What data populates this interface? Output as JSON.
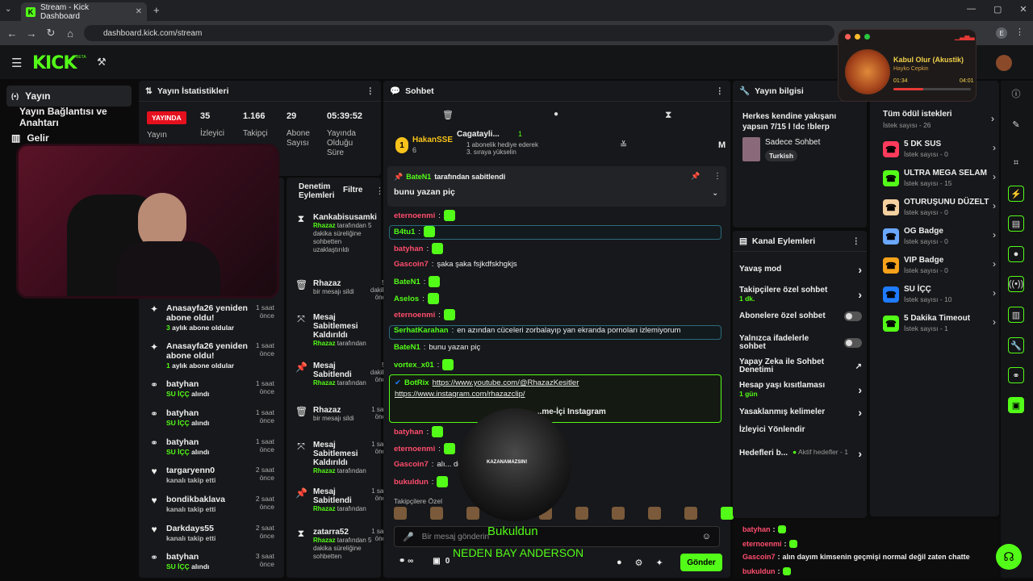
{
  "browser": {
    "tab_title": "Stream - Kick Dashboard",
    "url": "dashboard.kick.com/stream",
    "profile": "E"
  },
  "header": {
    "logo": "KICK",
    "beta": "BETA"
  },
  "sidenav": {
    "items": [
      {
        "label": "Yayın",
        "icon": "broadcast-icon"
      },
      {
        "label": "Yayın Bağlantısı ve Anahtarı",
        "icon": "key-icon"
      },
      {
        "label": "Gelir",
        "icon": "chart-icon"
      }
    ]
  },
  "stats": {
    "title": "Yayın İstatistikleri",
    "live_badge": "YAYINDA",
    "live_label": "Yayın",
    "items": [
      {
        "value": "35",
        "label": "İzleyici"
      },
      {
        "value": "1.166",
        "label": "Takipçi"
      },
      {
        "value": "29",
        "label": "Abone Sayısı"
      },
      {
        "value": "05:39:52",
        "label": "Yayında Olduğu Süre"
      }
    ]
  },
  "activity": [
    {
      "icon": "sparkle-icon",
      "name": "Anasayfa26 yeniden abone oldu!",
      "count": "3",
      "sub": " aylık abone oldular",
      "time": "1 saat önce"
    },
    {
      "icon": "sparkle-icon",
      "name": "Anasayfa26 yeniden abone oldu!",
      "count": "1",
      "sub": " aylık abone oldular",
      "time": "1 saat önce"
    },
    {
      "icon": "redeem-icon",
      "name": "batyhan",
      "count": "SU İÇÇ",
      "sub": " alındı",
      "time": "1 saat önce"
    },
    {
      "icon": "redeem-icon",
      "name": "batyhan",
      "count": "SU İÇÇ",
      "sub": " alındı",
      "time": "1 saat önce"
    },
    {
      "icon": "redeem-icon",
      "name": "batyhan",
      "count": "SU İÇÇ",
      "sub": " alındı",
      "time": "1 saat önce"
    },
    {
      "icon": "heart-icon",
      "name": "targaryenn0",
      "count": "",
      "sub": "kanalı takip etti",
      "time": "2 saat önce"
    },
    {
      "icon": "heart-icon",
      "name": "bondikbaklava",
      "count": "",
      "sub": "kanalı takip etti",
      "time": "2 saat önce"
    },
    {
      "icon": "heart-icon",
      "name": "Darkdays55",
      "count": "",
      "sub": "kanalı takip etti",
      "time": "2 saat önce"
    },
    {
      "icon": "redeem-icon",
      "name": "batyhan",
      "count": "SU İÇÇ",
      "sub": " alındı",
      "time": "3 saat önce"
    }
  ],
  "moderation": {
    "title": "Denetim Eylemleri",
    "filter": "Filtre",
    "items": [
      {
        "icon": "hourglass-icon",
        "title": "Kankabisusamki",
        "by": "Rhazaz",
        "desc": " tarafından 5 dakika süreliğine sohbetten uzaklaştırıldı",
        "time": ""
      },
      {
        "icon": "trash-icon",
        "title": "Rhazaz",
        "by": "",
        "desc": "bir mesajı sildi",
        "time": "52 dakika önce"
      },
      {
        "icon": "unpin-icon",
        "title": "Mesaj Sabitlemesi Kaldırıldı",
        "by": "Rhazaz",
        "desc": " tarafından",
        "time": "5"
      },
      {
        "icon": "pin-icon",
        "title": "Mesaj Sabitlendi",
        "by": "Rhazaz",
        "desc": " tarafından",
        "time": "57 dakika önce"
      },
      {
        "icon": "trash-icon",
        "title": "Rhazaz",
        "by": "",
        "desc": "bir mesajı sildi",
        "time": "1 saat önce"
      },
      {
        "icon": "unpin-icon",
        "title": "Mesaj Sabitlemesi Kaldırıldı",
        "by": "Rhazaz",
        "desc": " tarafından",
        "time": "1 saat önce"
      },
      {
        "icon": "pin-icon",
        "title": "Mesaj Sabitlendi",
        "by": "Rhazaz",
        "desc": " tarafından",
        "time": "1 saat önce"
      },
      {
        "icon": "hourglass-icon",
        "title": "zatarra52",
        "by": "Rhazaz",
        "desc": " tarafından 5 dakika süreliğine sohbetten",
        "time": "1 saat önce"
      }
    ]
  },
  "chat": {
    "title": "Sohbet",
    "top_user": "HakanSSE",
    "top_user_count": "6",
    "top_rank": "1",
    "gift_user": "Cagatayli...",
    "gift_count": "1",
    "gift_text": "1 abonelik hediye ederek 3. sıraya yükselin",
    "pinned_by": "BateN1",
    "pinned_label": " tarafından sabitlendi",
    "pinned_text": "bunu yazan piç",
    "messages": [
      {
        "user": "eternoenmi",
        "color": "#ff4d6d",
        "text": ""
      },
      {
        "user": "B4tu1",
        "color": "#53fc18",
        "text": ""
      },
      {
        "user": "batyhan",
        "color": "#ff4d6d",
        "text": ""
      },
      {
        "user": "Gascoin7",
        "color": "#ff4d6d",
        "text": "şaka şaka fsjkdfskhgkjs"
      },
      {
        "user": "BateN1",
        "color": "#53fc18",
        "text": ""
      },
      {
        "user": "Aselos",
        "color": "#53fc18",
        "text": ""
      },
      {
        "user": "eternoenmi",
        "color": "#ff4d6d",
        "text": ""
      },
      {
        "user": "SerhatKarahan",
        "color": "#53fc18",
        "text": "en azından cüceleri zorbalayıp yan ekranda pornoları izlemiyorum"
      },
      {
        "user": "BateN1",
        "color": "#53fc18",
        "text": "bunu yazan piç"
      },
      {
        "user": "vortex_x01",
        "color": "#53fc18",
        "text": ""
      }
    ],
    "botrix_user": "BotRix",
    "botrix_link1": "https://www.youtube.com/@RhazazKesitler",
    "botrix_link2": "https://www.instagram.com/rhazazclip/",
    "botrix_button": "...me-İçi Instagram",
    "messages2": [
      {
        "user": "batyhan",
        "color": "#ff4d6d",
        "text": ""
      },
      {
        "user": "eternoenmi",
        "color": "#ff4d6d",
        "text": ""
      },
      {
        "user": "Gascoin7",
        "color": "#ff4d6d",
        "text": "alı... değil zaten chatte"
      },
      {
        "user": "bukuldun",
        "color": "#ff4d6d",
        "text": ""
      }
    ],
    "followers_only": "Takipçilere Özel",
    "placeholder": "Bir mesaj gönderin",
    "send": "Gönder",
    "points": "0"
  },
  "overlay": {
    "sub_name": "Bukuldun",
    "caption": "NEDEN BAY ANDERSON",
    "video_text": "KAZANAMAZSIN!"
  },
  "info": {
    "title": "Yayın bilgisi",
    "stream_title": "Herkes kendine yakışanı yapsın 7/15 l !dc !blerp",
    "category": "Sadece Sohbet",
    "language": "Turkish"
  },
  "channel": {
    "title": "Kanal Eylemleri",
    "items": [
      {
        "label": "Yavaş mod",
        "sub": "",
        "ctrl": "chev"
      },
      {
        "label": "Takipçilere özel sohbet",
        "sub": "1 dk.",
        "ctrl": "chev"
      },
      {
        "label": "Abonelere özel sohbet",
        "sub": "",
        "ctrl": "toggle"
      },
      {
        "label": "Yalnızca ifadelerle sohbet",
        "sub": "",
        "ctrl": "toggle"
      },
      {
        "label": "Yapay Zeka ile Sohbet Denetimi",
        "sub": "",
        "ctrl": "ext"
      },
      {
        "label": "Hesap yaşı kısıtlaması",
        "sub": "1 gün",
        "ctrl": "chev"
      },
      {
        "label": "Yasaklanmış kelimeler",
        "sub": "",
        "ctrl": "chev"
      },
      {
        "label": "İzleyici Yönlendir",
        "sub": "",
        "ctrl": ""
      },
      {
        "label": "Hedefleri b...",
        "sub": "",
        "ctrl": "chev"
      }
    ],
    "goals_status": "Aktif hedefler - 1"
  },
  "mini_chat": [
    {
      "user": "batyhan",
      "text": ""
    },
    {
      "user": "eternoenmi",
      "text": ""
    },
    {
      "user": "Gascoin7",
      "text": "alın dayım kimsenin geçmişi normal değil zaten chatte"
    },
    {
      "user": "bukuldun",
      "text": ""
    }
  ],
  "rewards": {
    "all_label": "Tüm ödül istekleri",
    "all_count": "İstek sayısı - 26",
    "items": [
      {
        "name": "5 DK SUS",
        "count": "İstek sayısı - 0",
        "color": "#ff3b5c"
      },
      {
        "name": "ULTRA MEGA SELAM",
        "count": "İstek sayısı - 15",
        "color": "#53fc18"
      },
      {
        "name": "OTURUŞUNU DÜZELT",
        "count": "İstek sayısı - 0",
        "color": "#f5d0a0"
      },
      {
        "name": "OG Badge",
        "count": "İstek sayısı - 0",
        "color": "#6aa8ff"
      },
      {
        "name": "VIP Badge",
        "count": "İstek sayısı - 0",
        "color": "#f7a21b"
      },
      {
        "name": "SU İÇÇ",
        "count": "İstek sayısı - 10",
        "color": "#1f7bff"
      },
      {
        "name": "5 Dakika Timeout",
        "count": "İstek sayısı - 1",
        "color": "#53fc18"
      }
    ]
  },
  "music": {
    "song": "Kabul Olur (Akustik)",
    "artist": "Hayko Cepkin",
    "elapsed": "01:34",
    "total": "04:01",
    "progress": 0.39
  }
}
